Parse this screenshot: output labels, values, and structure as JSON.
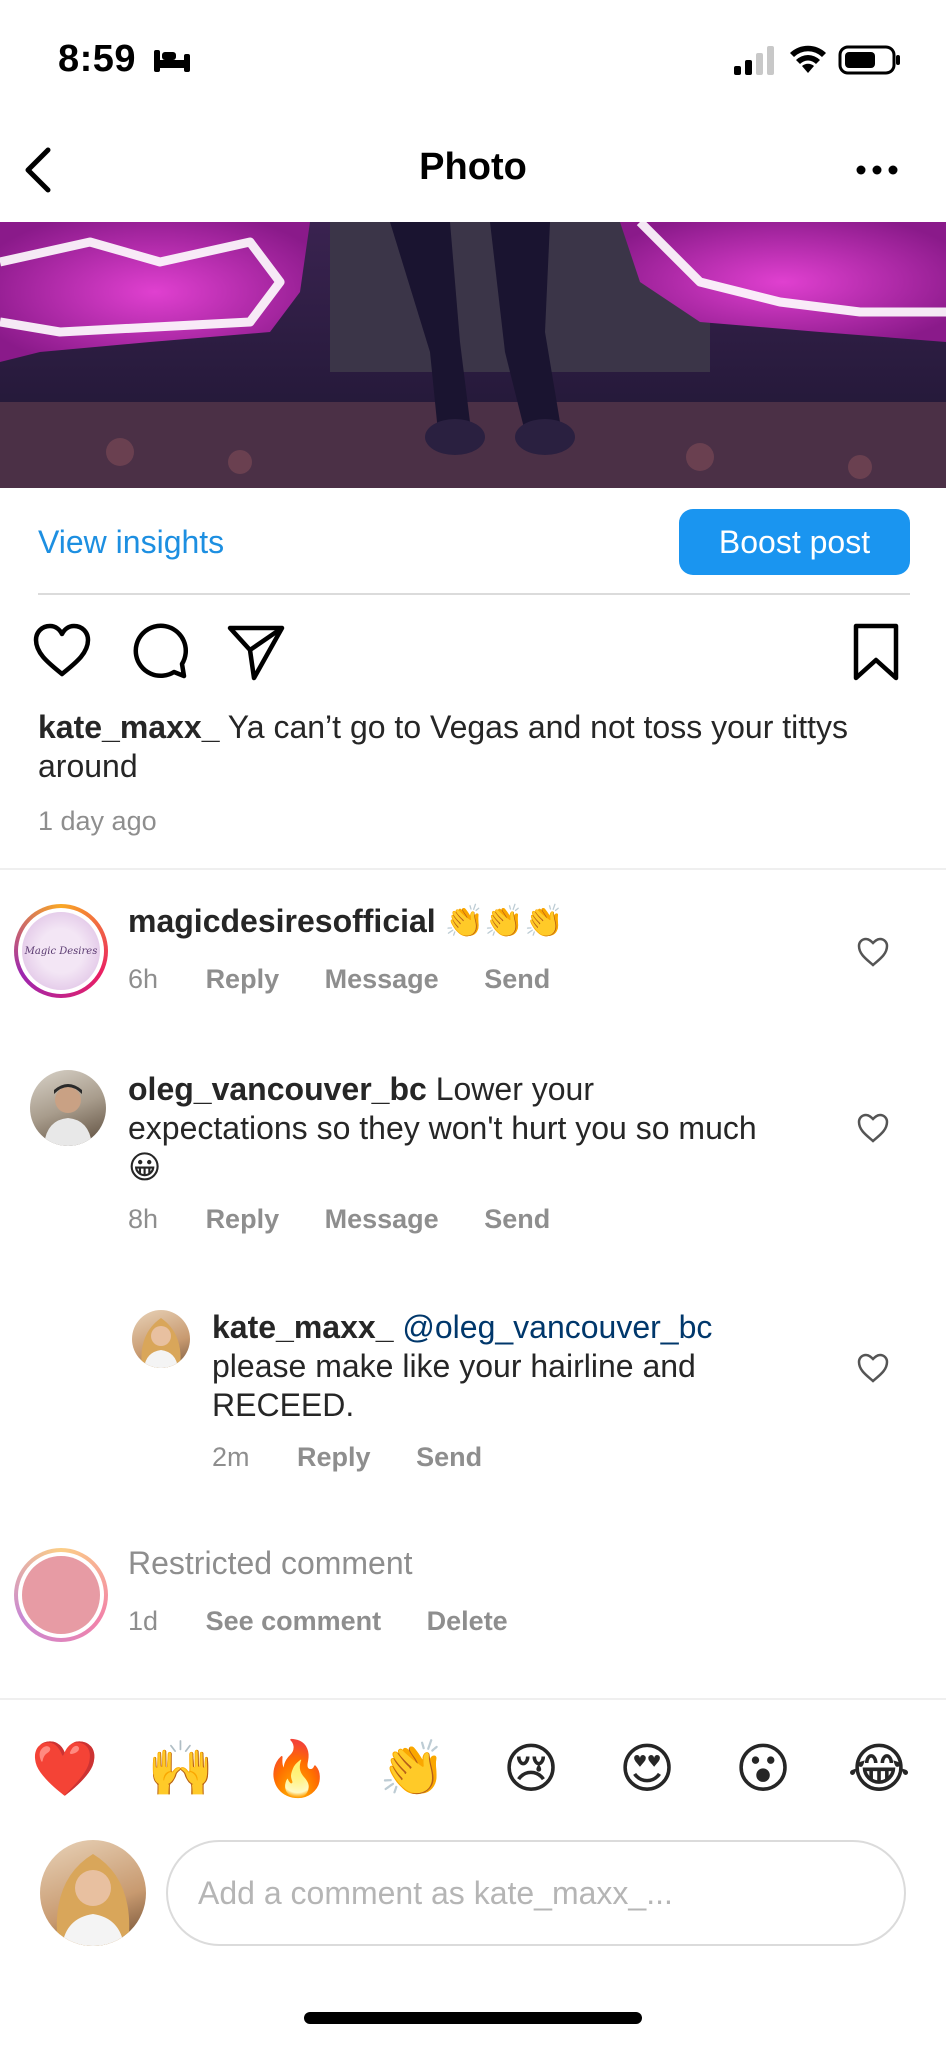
{
  "status_bar": {
    "time": "8:59"
  },
  "nav": {
    "title": "Photo"
  },
  "insights": {
    "view_insights_label": "View insights",
    "boost_label": "Boost post"
  },
  "caption": {
    "username": "kate_maxx_",
    "text": " Ya can’t go to Vegas and not toss your tittys around",
    "time": "1 day ago"
  },
  "comments": [
    {
      "username": "magicdesiresofficial",
      "text": " 👏👏👏",
      "time": "6h",
      "actions": [
        "Reply",
        "Message",
        "Send"
      ]
    },
    {
      "username": "oleg_vancouver_bc",
      "text": " Lower your expectations so they won't hurt you so much 😀",
      "time": "8h",
      "actions": [
        "Reply",
        "Message",
        "Send"
      ]
    },
    {
      "username": "kate_maxx_",
      "mention": "@oleg_vancouver_bc",
      "text": "please make like your hairline and RECEED.",
      "time": "2m",
      "actions": [
        "Reply",
        "Send"
      ]
    },
    {
      "text": "Restricted comment",
      "time": "1d",
      "actions": [
        "See comment",
        "Delete"
      ]
    }
  ],
  "avatar_labels": {
    "magicdesires": "Magic Desires"
  },
  "emojis": [
    "❤️",
    "🙌",
    "🔥",
    "👏",
    "😢",
    "😍",
    "😮",
    "😂"
  ],
  "composer": {
    "placeholder": "Add a comment as kate_maxx_..."
  },
  "colors": {
    "accent": "#1a95f0",
    "link": "#1d8fe1",
    "mention": "#00376b",
    "muted": "#8e8e8e"
  }
}
